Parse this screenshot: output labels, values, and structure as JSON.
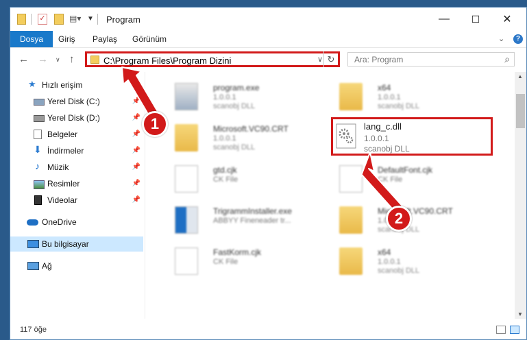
{
  "window": {
    "title": "Program",
    "minimize": "—",
    "maximize": "☐",
    "close": "✕"
  },
  "ribbon": {
    "tabs": [
      {
        "label": "Dosya"
      },
      {
        "label": "Giriş"
      },
      {
        "label": "Paylaş"
      },
      {
        "label": "Görünüm"
      }
    ],
    "help": "?"
  },
  "address": {
    "path": "C:\\Program Files\\Program Dizini",
    "search_placeholder": "Ara: Program"
  },
  "sidebar": {
    "items": [
      {
        "label": "Hızlı erişim"
      },
      {
        "label": "Yerel Disk (C:)"
      },
      {
        "label": "Yerel Disk (D:)"
      },
      {
        "label": "Belgeler"
      },
      {
        "label": "İndirmeler"
      },
      {
        "label": "Müzik"
      },
      {
        "label": "Resimler"
      },
      {
        "label": "Videolar"
      },
      {
        "label": "OneDrive"
      },
      {
        "label": "Bu bilgisayar"
      },
      {
        "label": "Ağ"
      }
    ]
  },
  "files": [
    {
      "name": "program.exe",
      "version": "1.0.0.1",
      "company": "scanobj DLL"
    },
    {
      "name": "x64",
      "version": "1.0.0.1",
      "company": "scanobj DLL"
    },
    {
      "name": "Microsoft.VC90.CRT",
      "version": "1.0.0.1",
      "company": "scanobj DLL"
    },
    {
      "name": "lang_c.dll",
      "version": "1.0.0.1",
      "company": "scanobj DLL"
    },
    {
      "name": "gtd.cjk",
      "version": "CK File",
      "company": ""
    },
    {
      "name": "DefaultFont.cjk",
      "version": "CK File",
      "company": ""
    },
    {
      "name": "TrigrammInstaller.exe",
      "version": "ABBYY Fineneader tr...",
      "company": ""
    },
    {
      "name": "Microsoft.VC90.CRT",
      "version": "1.0.0.1",
      "company": "scanobj DLL"
    },
    {
      "name": "FastKorm.cjk",
      "version": "CK File",
      "company": ""
    },
    {
      "name": "x64",
      "version": "1.0.0.1",
      "company": "scanobj DLL"
    }
  ],
  "status": {
    "count": "117 öğe"
  },
  "annotations": {
    "badge1": "1",
    "badge2": "2",
    "color": "#d21a1a"
  }
}
